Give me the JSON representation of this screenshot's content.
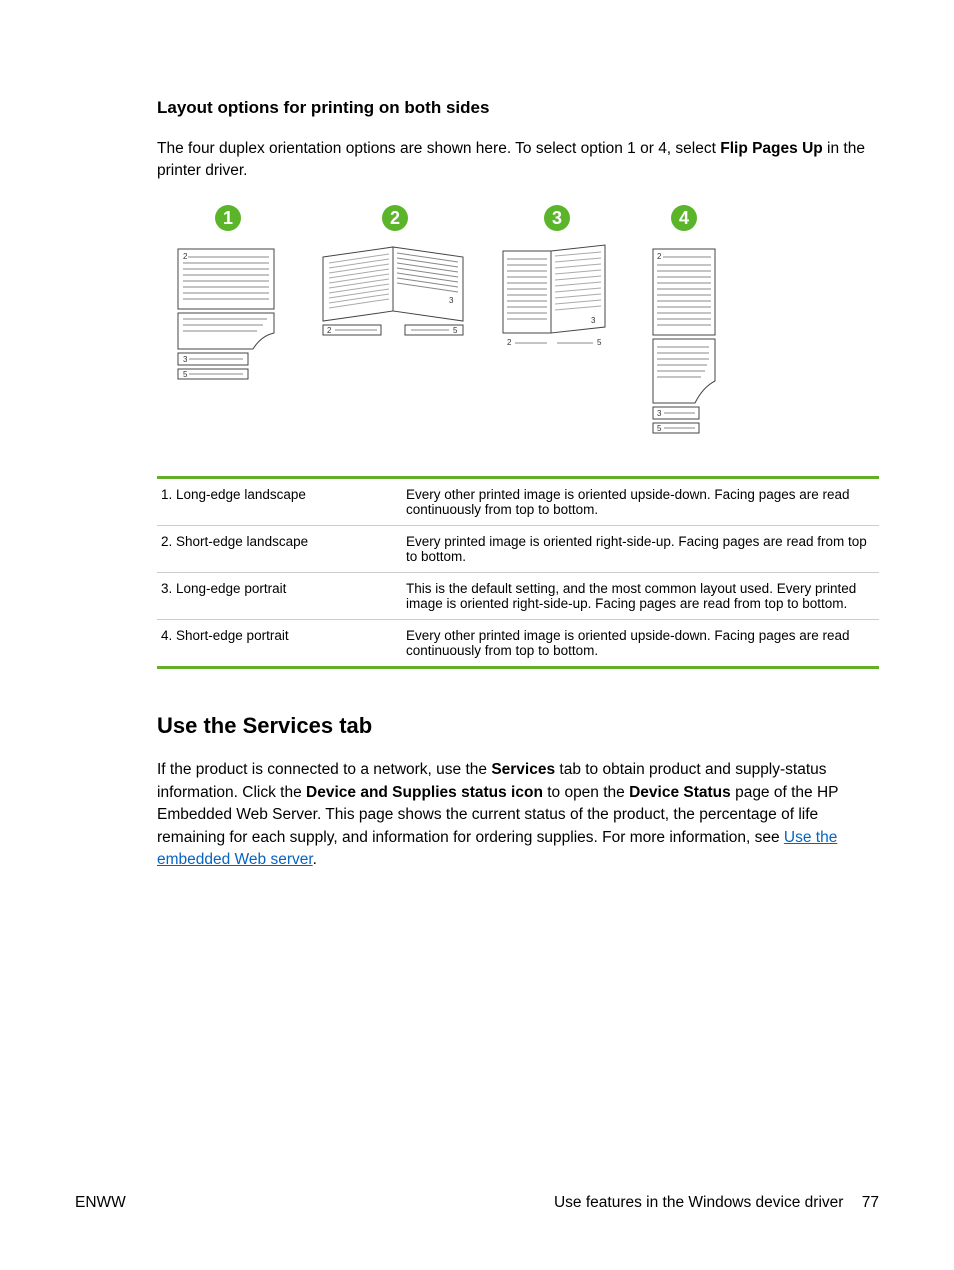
{
  "heading_layout": "Layout options for printing on both sides",
  "intro": {
    "part1": "The four duplex orientation options are shown here. To select option 1 or 4, select ",
    "bold": "Flip Pages Up",
    "part2": " in the printer driver."
  },
  "figure_numbers": [
    "1",
    "2",
    "3",
    "4"
  ],
  "diagram_labels": {
    "p2": "2",
    "p3": "3",
    "p5": "5"
  },
  "table": [
    {
      "label": "1. Long-edge landscape",
      "desc": "Every other printed image is oriented upside-down. Facing pages are read continuously from top to bottom."
    },
    {
      "label": "2. Short-edge landscape",
      "desc": "Every printed image is oriented right-side-up. Facing pages are read from top to bottom."
    },
    {
      "label": "3. Long-edge portrait",
      "desc": "This is the default setting, and the most common layout used. Every printed image is oriented right-side-up. Facing pages are read from top to bottom."
    },
    {
      "label": "4. Short-edge portrait",
      "desc": "Every other printed image is oriented upside-down. Facing pages are read continuously from top to bottom."
    }
  ],
  "section2_heading": "Use the Services tab",
  "section2_para": {
    "t1": "If the product is connected to a network, use the ",
    "b1": "Services",
    "t2": " tab to obtain product and supply-status information. Click the ",
    "b2": "Device and Supplies status icon",
    "t3": " to open the ",
    "b3": "Device Status",
    "t4": " page of the HP Embedded Web Server. This page shows the current status of the product, the percentage of life remaining for each supply, and information for ordering supplies. For more information, see ",
    "link": "Use the embedded Web server",
    "t5": "."
  },
  "footer_left": "ENWW",
  "footer_label": "Use features in the Windows device driver",
  "footer_page": "77"
}
